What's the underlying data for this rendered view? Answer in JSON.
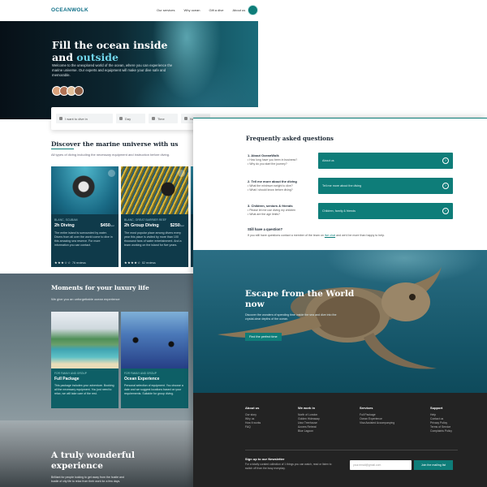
{
  "nav": {
    "logo": "OCEANWOLK",
    "links": [
      "Our services",
      "Why ocean",
      "Gift a dive",
      "About us"
    ]
  },
  "hero": {
    "title_line1": "Fill the ocean inside",
    "title_line2_plain": "and ",
    "title_line2_accent": "outside",
    "text": "Welcome to the unexplored world of the ocean, where you can experience the marine universe. Our experts and equipment will make your dive safe and memorable.",
    "search": {
      "place": "I want to dive in",
      "day": "Day",
      "time": "Time",
      "number": "Numb"
    }
  },
  "discover": {
    "title": "Discover the marine universe with us",
    "subtitle": "All types of diving including the necessary equipment and instruction before diving."
  },
  "tours": [
    {
      "meta": "BLANC, SCUBAM",
      "name": "2h Diving",
      "price": "$450",
      "unit": "/per",
      "desc": "The entire island is surrounded by water. Divers from all over the world come to dive in this amazing sea reserve. For more information you can contact.",
      "stars": "★★★☆☆",
      "reviews": "76 reviews"
    },
    {
      "meta": "BLANC, GREAT BARRIER REEF",
      "name": "2h Group Diving",
      "price": "$250",
      "unit": "/per",
      "desc": "The most popular place among divers every year this place is visited by more than 100 thousand fans of water entertainment. And a team working on the island for five years.",
      "stars": "★★★★☆",
      "reviews": "82 reviews"
    }
  ],
  "luxury": {
    "title": "Moments for your luxury life",
    "subtitle": "We give you an unforgettable ocean experience",
    "cards": [
      {
        "tag": "FOR FAMILY AND GROUP",
        "title": "Full Package",
        "text": "This package includes your adventure. Booking all the necessary equipment. You just need to relax, we will take care of the rest."
      },
      {
        "tag": "FOR FAMILY AND GROUP",
        "title": "Ocean Experience",
        "text": "Personal selection of equipment. You choose a date and we suggest locations based on your requirements. Suitable for group diving."
      }
    ]
  },
  "wonder": {
    "title": "A truly wonderful experience",
    "text": "Brilliant for people looking to get away from the hustle and bustle of city life to relax from their work for a few days."
  },
  "faq": {
    "title": "Frequently asked questions",
    "items": [
      {
        "q": "1. About OceanWolk",
        "d1": "• How long have you been in business?",
        "d2": "• Why do you start the journey?",
        "box": "About us"
      },
      {
        "q": "2. Tell me more about the diving",
        "d1": "• What the minimum weight to dive?",
        "d2": "• What I should know before diving?",
        "box": "Tell me more about the diving"
      },
      {
        "q": "3. Children, seniors & friends",
        "d1": "• Please let me use diving my children",
        "d2": "• What are the age limits?",
        "box": "Children, family & friends"
      }
    ],
    "still_title": "Still have a question?",
    "still_text_before": "If you still have questions contact a member of the team on ",
    "still_link": "live chat",
    "still_text_after": " and we'd be more than happy to help."
  },
  "escape": {
    "title_line1": "Escape from the World",
    "title_line2": "now",
    "text": "Discover the wonders of spending time inside the sea and dive into the crystal-clear depths of the ocean.",
    "button": "Find the perfect time"
  },
  "footer": {
    "columns": [
      {
        "title": "About us",
        "items": [
          "Our story",
          "Why us",
          "How it works",
          "FAQ"
        ]
      },
      {
        "title": "We work in",
        "items": [
          "North of London",
          "Golden Hideaway",
          "Ussr Treehouse",
          "Azores Retreat",
          "Blue Lagoon"
        ]
      },
      {
        "title": "Services",
        "items": [
          "Full Package",
          "Ocean Experience",
          "Visa Assisted Accompanying"
        ]
      },
      {
        "title": "Support",
        "items": [
          "Help",
          "Contact us",
          "Privacy Policy",
          "Terms of Service",
          "Complaints Policy"
        ]
      }
    ],
    "signup_title": "Sign up to our Newsletter",
    "signup_text": "For a totally curated collection of 1 things you can watch, read or listen to switch off from the busy everyday.",
    "email_placeholder": "your.email@gmail.com",
    "join_button": "Join the mailing list"
  },
  "colors": {
    "brand": "#0e7d79",
    "accent_text": "#6fd3e8",
    "footer_bg": "#232323"
  }
}
